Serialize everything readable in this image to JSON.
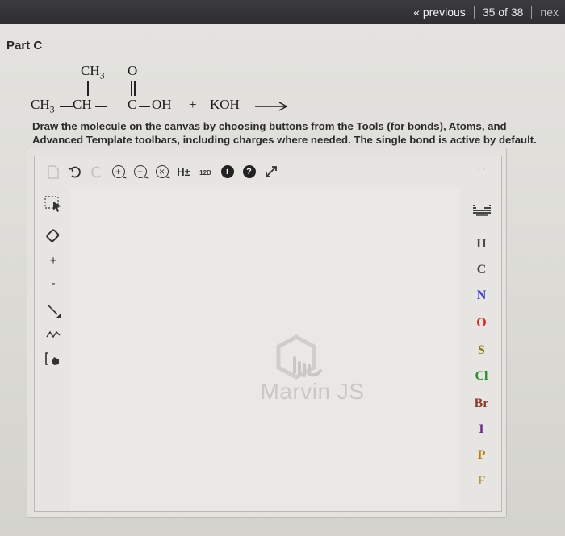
{
  "nav": {
    "previous_label": "« previous",
    "counter": "35 of 38",
    "next_label": "nex"
  },
  "part": {
    "title": "Part C"
  },
  "reaction": {
    "ch3_top": "CH",
    "ch3_top_sub": "3",
    "o_top": "O",
    "ch3_left": "CH",
    "ch3_left_sub": "3",
    "ch": "CH",
    "c": "C",
    "oh": "OH",
    "plus": "+",
    "koh": "KOH"
  },
  "instructions": "Draw the molecule on the canvas by choosing buttons from the Tools (for bonds), Atoms, and Advanced Template toolbars, including charges where needed. The single bond is active by default.",
  "toolbar": {
    "h_toggle": "H±",
    "two_d": "12D"
  },
  "left_tools": {
    "plus": "+",
    "minus": "-"
  },
  "watermark": "Marvin JS",
  "atoms": [
    {
      "symbol": "H",
      "color": "#4a4a4a"
    },
    {
      "symbol": "C",
      "color": "#4a4a4a"
    },
    {
      "symbol": "N",
      "color": "#3b3fd0"
    },
    {
      "symbol": "O",
      "color": "#d02a2a"
    },
    {
      "symbol": "S",
      "color": "#8d7a12"
    },
    {
      "symbol": "Cl",
      "color": "#2e8a2e"
    },
    {
      "symbol": "Br",
      "color": "#8a3a2a"
    },
    {
      "symbol": "I",
      "color": "#6a2a8a"
    },
    {
      "symbol": "P",
      "color": "#c07a10"
    },
    {
      "symbol": "F",
      "color": "#b59a4a"
    }
  ]
}
